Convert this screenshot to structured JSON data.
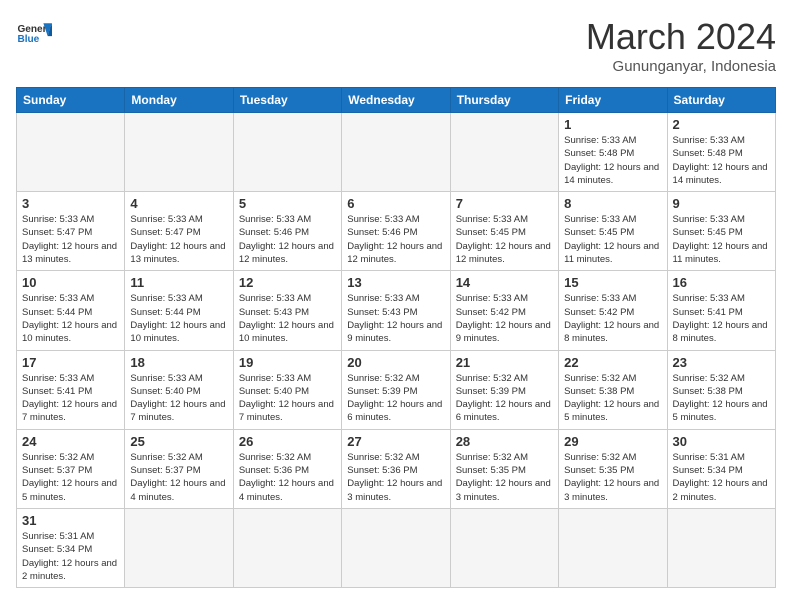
{
  "header": {
    "logo_general": "General",
    "logo_blue": "Blue",
    "month": "March 2024",
    "location": "Gununganyar, Indonesia"
  },
  "days_of_week": [
    "Sunday",
    "Monday",
    "Tuesday",
    "Wednesday",
    "Thursday",
    "Friday",
    "Saturday"
  ],
  "weeks": [
    [
      {
        "day": "",
        "info": ""
      },
      {
        "day": "",
        "info": ""
      },
      {
        "day": "",
        "info": ""
      },
      {
        "day": "",
        "info": ""
      },
      {
        "day": "",
        "info": ""
      },
      {
        "day": "1",
        "info": "Sunrise: 5:33 AM\nSunset: 5:48 PM\nDaylight: 12 hours and 14 minutes."
      },
      {
        "day": "2",
        "info": "Sunrise: 5:33 AM\nSunset: 5:48 PM\nDaylight: 12 hours and 14 minutes."
      }
    ],
    [
      {
        "day": "3",
        "info": "Sunrise: 5:33 AM\nSunset: 5:47 PM\nDaylight: 12 hours and 13 minutes."
      },
      {
        "day": "4",
        "info": "Sunrise: 5:33 AM\nSunset: 5:47 PM\nDaylight: 12 hours and 13 minutes."
      },
      {
        "day": "5",
        "info": "Sunrise: 5:33 AM\nSunset: 5:46 PM\nDaylight: 12 hours and 12 minutes."
      },
      {
        "day": "6",
        "info": "Sunrise: 5:33 AM\nSunset: 5:46 PM\nDaylight: 12 hours and 12 minutes."
      },
      {
        "day": "7",
        "info": "Sunrise: 5:33 AM\nSunset: 5:45 PM\nDaylight: 12 hours and 12 minutes."
      },
      {
        "day": "8",
        "info": "Sunrise: 5:33 AM\nSunset: 5:45 PM\nDaylight: 12 hours and 11 minutes."
      },
      {
        "day": "9",
        "info": "Sunrise: 5:33 AM\nSunset: 5:45 PM\nDaylight: 12 hours and 11 minutes."
      }
    ],
    [
      {
        "day": "10",
        "info": "Sunrise: 5:33 AM\nSunset: 5:44 PM\nDaylight: 12 hours and 10 minutes."
      },
      {
        "day": "11",
        "info": "Sunrise: 5:33 AM\nSunset: 5:44 PM\nDaylight: 12 hours and 10 minutes."
      },
      {
        "day": "12",
        "info": "Sunrise: 5:33 AM\nSunset: 5:43 PM\nDaylight: 12 hours and 10 minutes."
      },
      {
        "day": "13",
        "info": "Sunrise: 5:33 AM\nSunset: 5:43 PM\nDaylight: 12 hours and 9 minutes."
      },
      {
        "day": "14",
        "info": "Sunrise: 5:33 AM\nSunset: 5:42 PM\nDaylight: 12 hours and 9 minutes."
      },
      {
        "day": "15",
        "info": "Sunrise: 5:33 AM\nSunset: 5:42 PM\nDaylight: 12 hours and 8 minutes."
      },
      {
        "day": "16",
        "info": "Sunrise: 5:33 AM\nSunset: 5:41 PM\nDaylight: 12 hours and 8 minutes."
      }
    ],
    [
      {
        "day": "17",
        "info": "Sunrise: 5:33 AM\nSunset: 5:41 PM\nDaylight: 12 hours and 7 minutes."
      },
      {
        "day": "18",
        "info": "Sunrise: 5:33 AM\nSunset: 5:40 PM\nDaylight: 12 hours and 7 minutes."
      },
      {
        "day": "19",
        "info": "Sunrise: 5:33 AM\nSunset: 5:40 PM\nDaylight: 12 hours and 7 minutes."
      },
      {
        "day": "20",
        "info": "Sunrise: 5:32 AM\nSunset: 5:39 PM\nDaylight: 12 hours and 6 minutes."
      },
      {
        "day": "21",
        "info": "Sunrise: 5:32 AM\nSunset: 5:39 PM\nDaylight: 12 hours and 6 minutes."
      },
      {
        "day": "22",
        "info": "Sunrise: 5:32 AM\nSunset: 5:38 PM\nDaylight: 12 hours and 5 minutes."
      },
      {
        "day": "23",
        "info": "Sunrise: 5:32 AM\nSunset: 5:38 PM\nDaylight: 12 hours and 5 minutes."
      }
    ],
    [
      {
        "day": "24",
        "info": "Sunrise: 5:32 AM\nSunset: 5:37 PM\nDaylight: 12 hours and 5 minutes."
      },
      {
        "day": "25",
        "info": "Sunrise: 5:32 AM\nSunset: 5:37 PM\nDaylight: 12 hours and 4 minutes."
      },
      {
        "day": "26",
        "info": "Sunrise: 5:32 AM\nSunset: 5:36 PM\nDaylight: 12 hours and 4 minutes."
      },
      {
        "day": "27",
        "info": "Sunrise: 5:32 AM\nSunset: 5:36 PM\nDaylight: 12 hours and 3 minutes."
      },
      {
        "day": "28",
        "info": "Sunrise: 5:32 AM\nSunset: 5:35 PM\nDaylight: 12 hours and 3 minutes."
      },
      {
        "day": "29",
        "info": "Sunrise: 5:32 AM\nSunset: 5:35 PM\nDaylight: 12 hours and 3 minutes."
      },
      {
        "day": "30",
        "info": "Sunrise: 5:31 AM\nSunset: 5:34 PM\nDaylight: 12 hours and 2 minutes."
      }
    ],
    [
      {
        "day": "31",
        "info": "Sunrise: 5:31 AM\nSunset: 5:34 PM\nDaylight: 12 hours and 2 minutes."
      },
      {
        "day": "",
        "info": ""
      },
      {
        "day": "",
        "info": ""
      },
      {
        "day": "",
        "info": ""
      },
      {
        "day": "",
        "info": ""
      },
      {
        "day": "",
        "info": ""
      },
      {
        "day": "",
        "info": ""
      }
    ]
  ]
}
